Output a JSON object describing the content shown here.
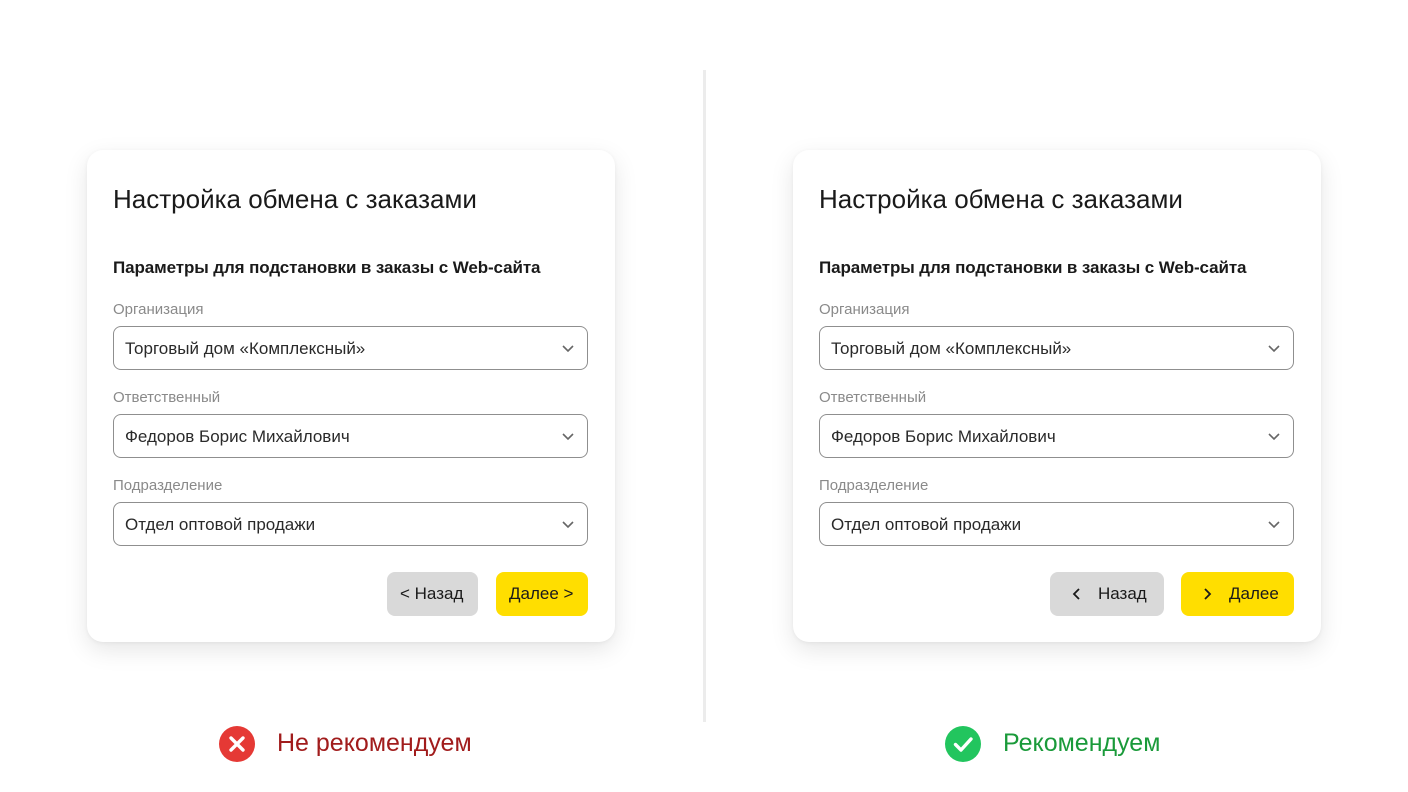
{
  "left_card": {
    "title": "Настройка обмена с заказами",
    "subtitle": "Параметры для подстановки в заказы с Web-сайта",
    "fields": [
      {
        "label": "Организация",
        "value": "Торговый дом «Комплексный»"
      },
      {
        "label": "Ответственный",
        "value": "Федоров Борис Михайлович"
      },
      {
        "label": "Подразделение",
        "value": "Отдел оптовой продажи"
      }
    ],
    "back_label": "< Назад",
    "next_label": "Далее >"
  },
  "right_card": {
    "title": "Настройка обмена с заказами",
    "subtitle": "Параметры для подстановки в заказы с Web-сайта",
    "fields": [
      {
        "label": "Организация",
        "value": "Торговый дом «Комплексный»"
      },
      {
        "label": "Ответственный",
        "value": "Федоров Борис Михайлович"
      },
      {
        "label": "Подразделение",
        "value": "Отдел оптовой продажи"
      }
    ],
    "back_label": "Назад",
    "next_label": "Далее"
  },
  "verdicts": {
    "bad": {
      "label": "Не рекомендуем",
      "icon": "error-x-icon",
      "color": "#e53935"
    },
    "good": {
      "label": "Рекомендуем",
      "icon": "check-icon",
      "color": "#22c55e"
    }
  },
  "colors": {
    "primary_button": "#ffde00",
    "secondary_button": "#d9d9d9",
    "bad_text": "#a11c1c",
    "good_text": "#1a9a3a"
  }
}
